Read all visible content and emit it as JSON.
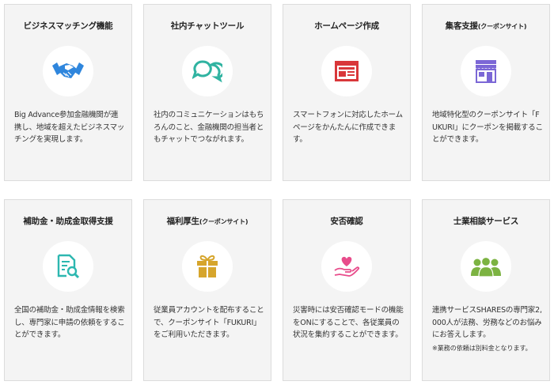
{
  "colors": {
    "card_bg": "#f4f4f4",
    "card_border": "#dcdcdc",
    "handshake_blue": "#2f86dd",
    "chat_teal": "#30b3a1",
    "homepage_red": "#d9373a",
    "shop_purple": "#7b67d6",
    "subsidy_teal": "#2db7b0",
    "gift_gold": "#d6a52c",
    "heart_pink": "#e84c8b",
    "people_green": "#7cb342"
  },
  "cards": [
    {
      "title": "ビジネスマッチング機能",
      "title_small": "",
      "icon": "handshake-icon",
      "desc": "Big Advance参加金融機関が連携し、地域を超えたビジネスマッチングを実現します。",
      "note": ""
    },
    {
      "title": "社内チャットツール",
      "title_small": "",
      "icon": "chat-bubbles-icon",
      "desc": "社内のコミュニケーションはもちろんのこと、金融機関の担当者ともチャットでつながれます。",
      "note": ""
    },
    {
      "title": "ホームページ作成",
      "title_small": "",
      "icon": "webpage-icon",
      "desc": "スマートフォンに対応したホームページをかんたんに作成できます。",
      "note": ""
    },
    {
      "title": "集客支援",
      "title_small": "(クーポンサイト)",
      "icon": "shop-icon",
      "desc": "地域特化型のクーポンサイト「FUKURI」にクーポンを掲載することができます。",
      "note": ""
    },
    {
      "title": "補助金・助成金取得支援",
      "title_small": "",
      "icon": "document-search-icon",
      "desc": "全国の補助金・助成金情報を検索し、専門家に申請の依頼をすることができます。",
      "note": ""
    },
    {
      "title": "福利厚生",
      "title_small": "(クーポンサイト)",
      "icon": "gift-icon",
      "desc": "従業員アカウントを配布することで、クーポンサイト「FUKURI」をご利用いただきます。",
      "note": ""
    },
    {
      "title": "安否確認",
      "title_small": "",
      "icon": "heart-hand-icon",
      "desc": "災害時には安否確認モードの機能をONにすることで、各従業員の状況を集約することができます。",
      "note": ""
    },
    {
      "title": "士業相談サービス",
      "title_small": "",
      "icon": "people-icon",
      "desc": "連携サービスSHARESの専門家2,000人が法務、労務などのお悩みにお答えします。",
      "note": "※業務の依頼は別料金となります。"
    }
  ]
}
